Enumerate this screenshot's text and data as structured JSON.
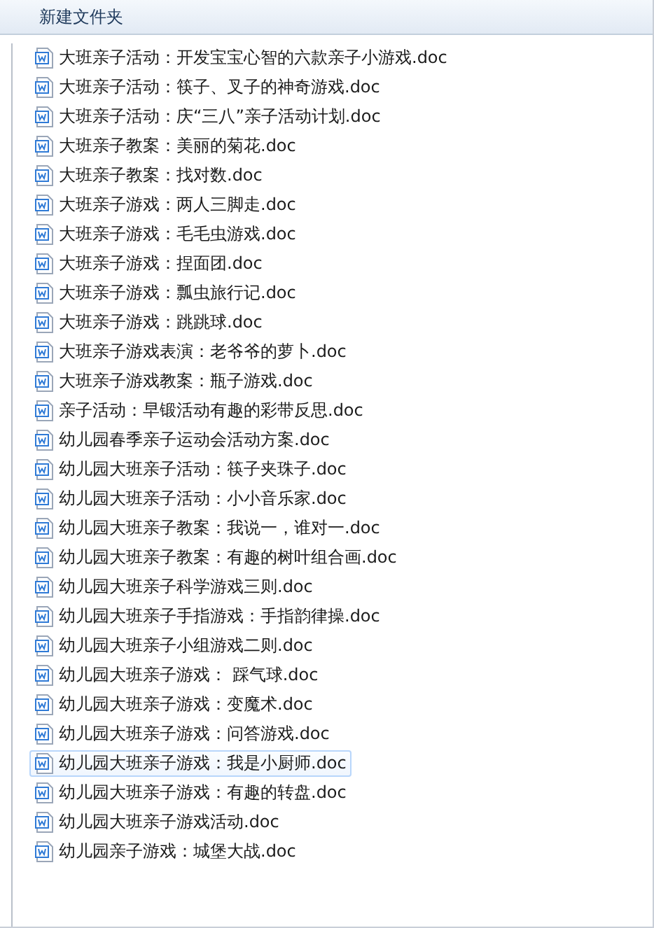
{
  "toolbar": {
    "new_folder": "新建文件夹"
  },
  "files": [
    {
      "name": "大班亲子活动：开发宝宝心智的六款亲子小游戏.doc",
      "selected": false
    },
    {
      "name": "大班亲子活动：筷子、叉子的神奇游戏.doc",
      "selected": false
    },
    {
      "name": "大班亲子活动：庆“三八”亲子活动计划.doc",
      "selected": false
    },
    {
      "name": "大班亲子教案：美丽的菊花.doc",
      "selected": false
    },
    {
      "name": "大班亲子教案：找对数.doc",
      "selected": false
    },
    {
      "name": "大班亲子游戏：两人三脚走.doc",
      "selected": false
    },
    {
      "name": "大班亲子游戏：毛毛虫游戏.doc",
      "selected": false
    },
    {
      "name": "大班亲子游戏：捏面团.doc",
      "selected": false
    },
    {
      "name": "大班亲子游戏：瓢虫旅行记.doc",
      "selected": false
    },
    {
      "name": "大班亲子游戏：跳跳球.doc",
      "selected": false
    },
    {
      "name": "大班亲子游戏表演：老爷爷的萝卜.doc",
      "selected": false
    },
    {
      "name": "大班亲子游戏教案：瓶子游戏.doc",
      "selected": false
    },
    {
      "name": "亲子活动：早锻活动有趣的彩带反思.doc",
      "selected": false
    },
    {
      "name": "幼儿园春季亲子运动会活动方案.doc",
      "selected": false
    },
    {
      "name": "幼儿园大班亲子活动：筷子夹珠子.doc",
      "selected": false
    },
    {
      "name": "幼儿园大班亲子活动：小小音乐家.doc",
      "selected": false
    },
    {
      "name": "幼儿园大班亲子教案：我说一，谁对一.doc",
      "selected": false
    },
    {
      "name": "幼儿园大班亲子教案：有趣的树叶组合画.doc",
      "selected": false
    },
    {
      "name": "幼儿园大班亲子科学游戏三则.doc",
      "selected": false
    },
    {
      "name": "幼儿园大班亲子手指游戏：手指韵律操.doc",
      "selected": false
    },
    {
      "name": "幼儿园大班亲子小组游戏二则.doc",
      "selected": false
    },
    {
      "name": "幼儿园大班亲子游戏： 踩气球.doc",
      "selected": false
    },
    {
      "name": "幼儿园大班亲子游戏：变魔术.doc",
      "selected": false
    },
    {
      "name": "幼儿园大班亲子游戏：问答游戏.doc",
      "selected": false
    },
    {
      "name": "幼儿园大班亲子游戏：我是小厨师.doc",
      "selected": true
    },
    {
      "name": "幼儿园大班亲子游戏：有趣的转盘.doc",
      "selected": false
    },
    {
      "name": "幼儿园大班亲子游戏活动.doc",
      "selected": false
    },
    {
      "name": "幼儿园亲子游戏：城堡大战.doc",
      "selected": false
    }
  ]
}
